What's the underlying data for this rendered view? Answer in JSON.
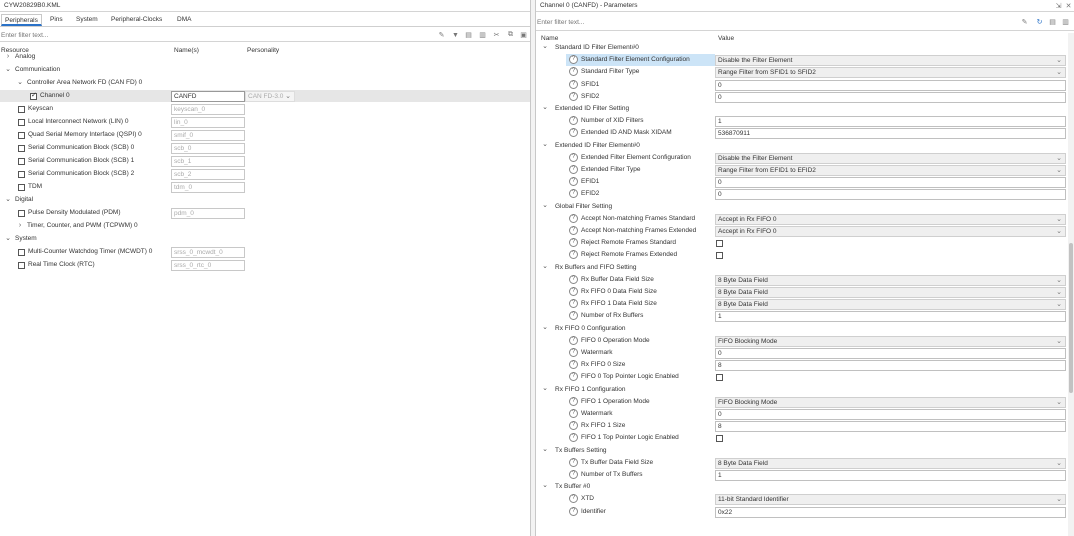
{
  "left": {
    "title": "CYW20829B0.KML",
    "tabs": [
      "Peripherals",
      "Pins",
      "System",
      "Peripheral-Clocks",
      "DMA"
    ],
    "filter_placeholder": "Enter filter text...",
    "columns": [
      "Resource",
      "Name(s)",
      "Personality"
    ],
    "tree": [
      {
        "label": "Analog",
        "expander": ">",
        "level": 0
      },
      {
        "label": "Communication",
        "expander": "v",
        "level": 0
      },
      {
        "label": "Controller Area Network FD (CAN FD) 0",
        "expander": "v",
        "level": 1
      },
      {
        "label": "Channel 0",
        "checkbox": true,
        "checked": true,
        "level": 2,
        "name": "CANFD",
        "personality": "CAN FD-3.0",
        "selected": true
      },
      {
        "label": "Keyscan",
        "checkbox": true,
        "level": 1,
        "name": "keyscan_0"
      },
      {
        "label": "Local Interconnect Network (LIN) 0",
        "checkbox": true,
        "level": 1,
        "name": "lin_0"
      },
      {
        "label": "Quad Serial Memory Interface (QSPI) 0",
        "checkbox": true,
        "level": 1,
        "name": "smif_0"
      },
      {
        "label": "Serial Communication Block (SCB) 0",
        "checkbox": true,
        "level": 1,
        "name": "scb_0"
      },
      {
        "label": "Serial Communication Block (SCB) 1",
        "checkbox": true,
        "level": 1,
        "name": "scb_1"
      },
      {
        "label": "Serial Communication Block (SCB) 2",
        "checkbox": true,
        "level": 1,
        "name": "scb_2"
      },
      {
        "label": "TDM",
        "checkbox": true,
        "level": 1,
        "name": "tdm_0"
      },
      {
        "label": "Digital",
        "expander": "v",
        "level": 0
      },
      {
        "label": "Pulse Density Modulated (PDM)",
        "checkbox": true,
        "level": 1,
        "name": "pdm_0"
      },
      {
        "label": "Timer, Counter, and PWM (TCPWM) 0",
        "expander": ">",
        "level": 1
      },
      {
        "label": "System",
        "expander": "v",
        "level": 0
      },
      {
        "label": "Multi-Counter Watchdog Timer (MCWDT) 0",
        "checkbox": true,
        "level": 1,
        "name": "srss_0_mcwdt_0"
      },
      {
        "label": "Real Time Clock (RTC)",
        "checkbox": true,
        "level": 1,
        "name": "srss_0_rtc_0"
      }
    ]
  },
  "right": {
    "title": "Channel 0 (CANFD) - Parameters",
    "filter_placeholder": "Enter filter text...",
    "columns": [
      "Name",
      "Value"
    ],
    "rows": [
      {
        "type": "group",
        "label": "Standard ID Filter Element#0"
      },
      {
        "type": "dropdown",
        "label": "Standard Filter Element Configuration",
        "value": "Disable the Filter Element",
        "highlight": true
      },
      {
        "type": "dropdown",
        "label": "Standard Filter Type",
        "value": "Range Filter from SFID1 to SFID2"
      },
      {
        "type": "text",
        "label": "SFID1",
        "value": "0"
      },
      {
        "type": "text",
        "label": "SFID2",
        "value": "0"
      },
      {
        "type": "group",
        "label": "Extended ID Filter Setting"
      },
      {
        "type": "text",
        "label": "Number of XID Filters",
        "value": "1"
      },
      {
        "type": "text",
        "label": "Extended ID AND Mask XIDAM",
        "value": "536870911"
      },
      {
        "type": "group",
        "label": "Extended ID Filter Element#0"
      },
      {
        "type": "dropdown",
        "label": "Extended Filter Element Configuration",
        "value": "Disable the Filter Element"
      },
      {
        "type": "dropdown",
        "label": "Extended Filter Type",
        "value": "Range Filter from EFID1 to EFID2"
      },
      {
        "type": "text",
        "label": "EFID1",
        "value": "0"
      },
      {
        "type": "text",
        "label": "EFID2",
        "value": "0"
      },
      {
        "type": "group",
        "label": "Global Filter Setting"
      },
      {
        "type": "dropdown",
        "label": "Accept Non-matching Frames Standard",
        "value": "Accept in Rx FIFO 0"
      },
      {
        "type": "dropdown",
        "label": "Accept Non-matching Frames Extended",
        "value": "Accept in Rx FIFO 0"
      },
      {
        "type": "checkbox",
        "label": "Reject Remote Frames Standard"
      },
      {
        "type": "checkbox",
        "label": "Reject Remote Frames Extended"
      },
      {
        "type": "group",
        "label": "Rx Buffers and FIFO Setting"
      },
      {
        "type": "dropdown",
        "label": "Rx Buffer Data Field Size",
        "value": "8 Byte Data Field"
      },
      {
        "type": "dropdown",
        "label": "Rx FIFO 0 Data Field Size",
        "value": "8 Byte Data Field"
      },
      {
        "type": "dropdown",
        "label": "Rx FIFO 1 Data Field Size",
        "value": "8 Byte Data Field"
      },
      {
        "type": "text",
        "label": "Number of Rx Buffers",
        "value": "1"
      },
      {
        "type": "group",
        "label": "Rx FIFO 0 Configuration"
      },
      {
        "type": "dropdown",
        "label": "FIFO 0 Operation Mode",
        "value": "FIFO Blocking Mode"
      },
      {
        "type": "text",
        "label": "Watermark",
        "value": "0"
      },
      {
        "type": "text",
        "label": "Rx FIFO 0 Size",
        "value": "8"
      },
      {
        "type": "checkbox",
        "label": "FIFO 0 Top Pointer Logic Enabled"
      },
      {
        "type": "group",
        "label": "Rx FIFO 1 Configuration"
      },
      {
        "type": "dropdown",
        "label": "FIFO 1 Operation Mode",
        "value": "FIFO Blocking Mode"
      },
      {
        "type": "text",
        "label": "Watermark",
        "value": "0"
      },
      {
        "type": "text",
        "label": "Rx FIFO 1 Size",
        "value": "8"
      },
      {
        "type": "checkbox",
        "label": "FIFO 1 Top Pointer Logic Enabled"
      },
      {
        "type": "group",
        "label": "Tx Buffers Setting"
      },
      {
        "type": "dropdown",
        "label": "Tx Buffer Data Field Size",
        "value": "8 Byte Data Field"
      },
      {
        "type": "text",
        "label": "Number of Tx Buffers",
        "value": "1"
      },
      {
        "type": "group",
        "label": "Tx Buffer #0"
      },
      {
        "type": "dropdown",
        "label": "XTD",
        "value": "11-bit Standard Identifier"
      },
      {
        "type": "text",
        "label": "Identifier",
        "value": "0x22"
      }
    ]
  },
  "icons": {
    "toolbar_left": [
      "eraser-icon",
      "filter-icon",
      "columns-icon",
      "layout-icon",
      "split-icon",
      "copy-icon",
      "paste-icon"
    ],
    "toolbar_right": [
      "eraser-icon",
      "refresh-icon",
      "collapse-icon",
      "expand-icon"
    ],
    "title_right": [
      "pin-icon",
      "close-icon"
    ]
  },
  "colors": {
    "accent": "#2a72c8",
    "selection": "#cce4f7",
    "row_selected": "#e6e6e6"
  }
}
